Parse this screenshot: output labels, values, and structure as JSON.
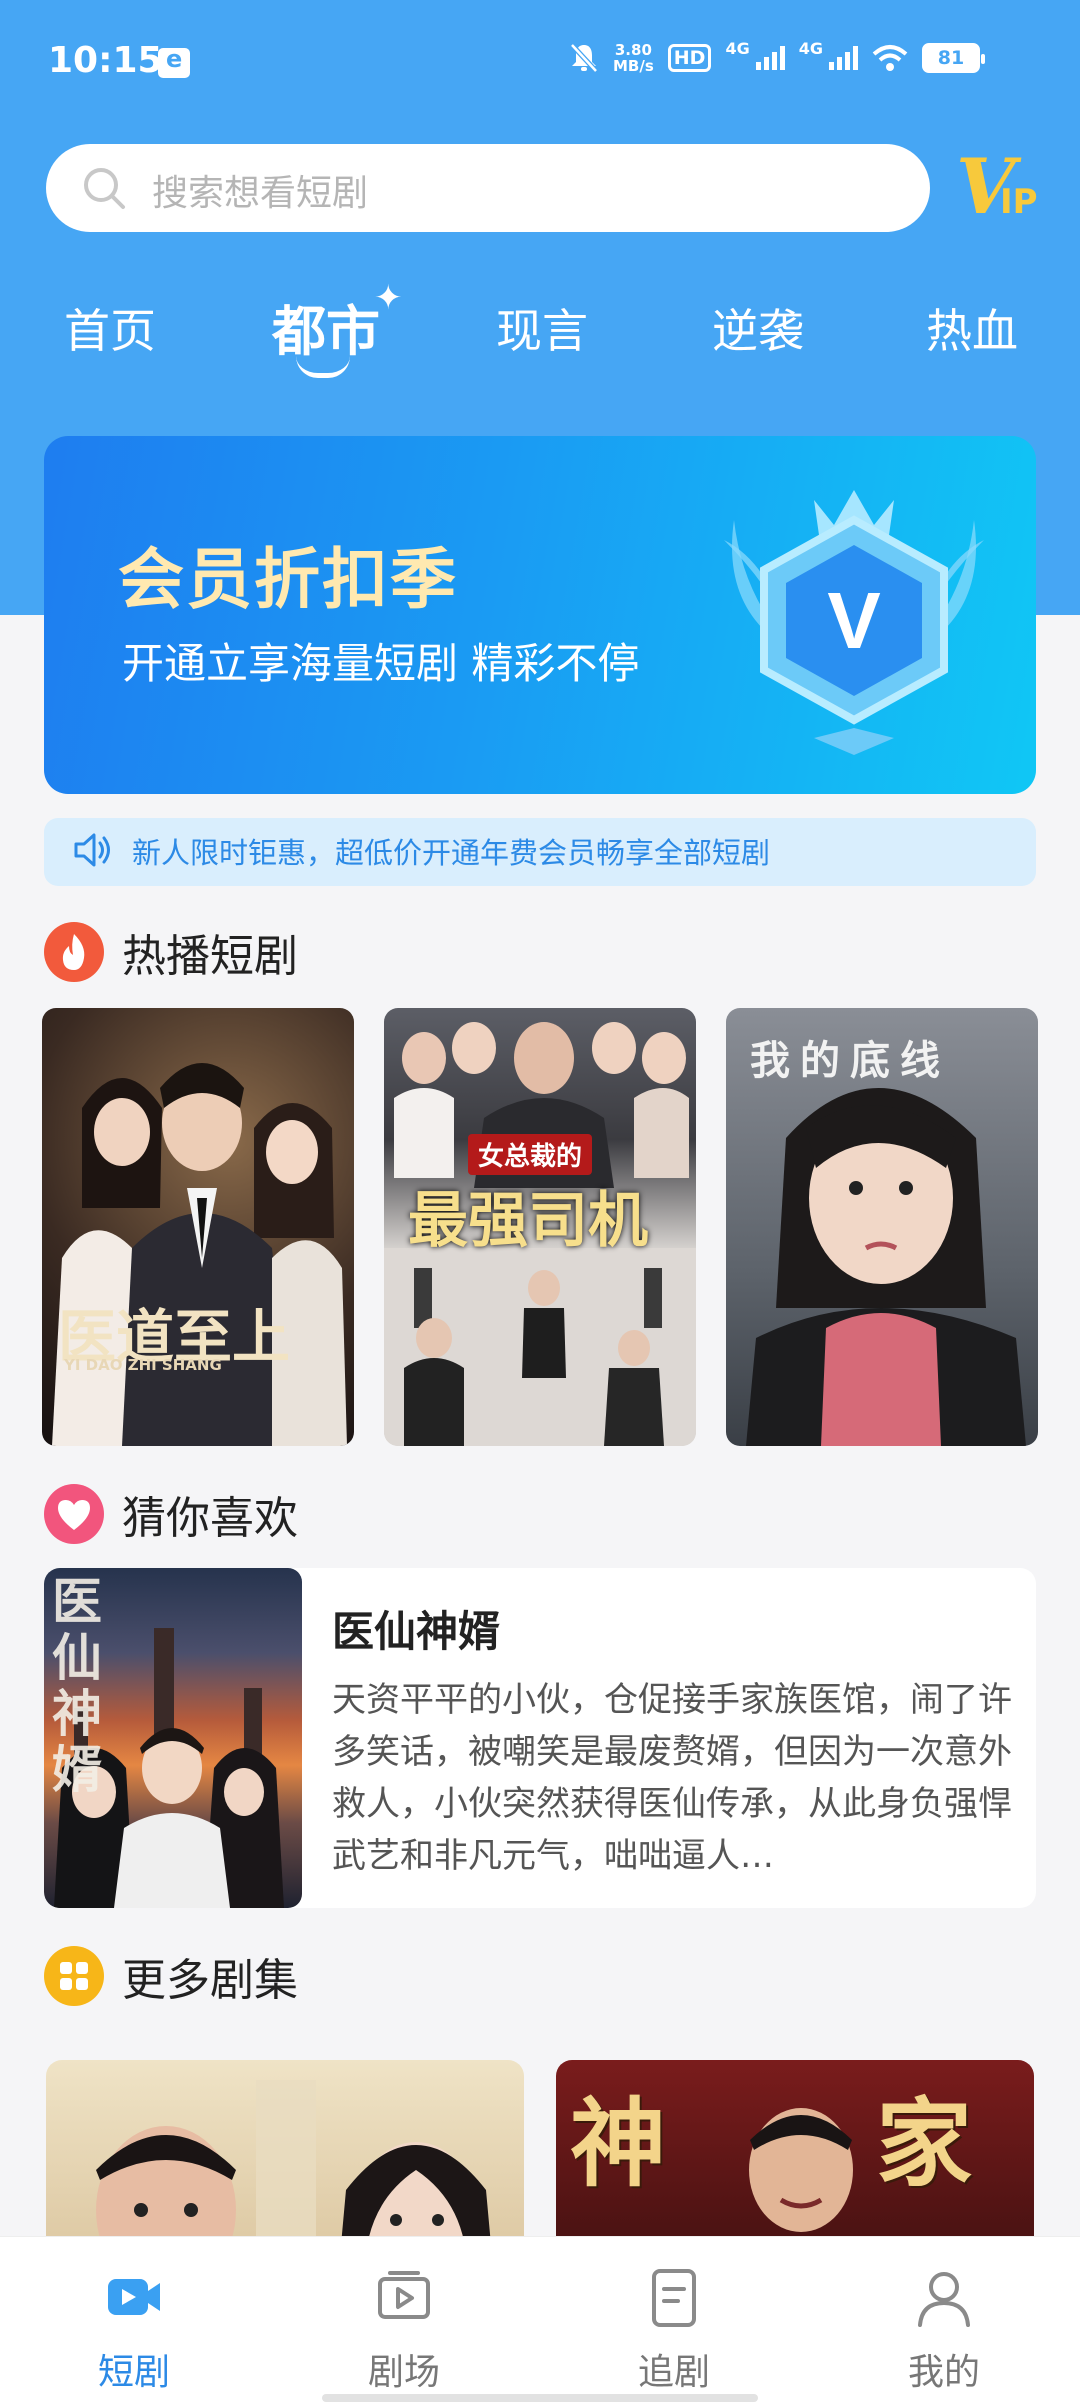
{
  "status_bar": {
    "time": "10:15",
    "speed_value": "3.80",
    "speed_unit": "MB/s",
    "hd": "HD",
    "sim1": "4G",
    "sim2": "4G",
    "battery": "81"
  },
  "search": {
    "placeholder": "搜索想看短剧"
  },
  "vip": {
    "v": "V",
    "ip": "IP"
  },
  "tabs": [
    {
      "label": "首页"
    },
    {
      "label": "都市",
      "active": true
    },
    {
      "label": "现言"
    },
    {
      "label": "逆袭"
    },
    {
      "label": "热血"
    }
  ],
  "banner": {
    "title": "会员折扣季",
    "subtitle": "开通立享海量短剧  精彩不停",
    "emblem_letter": "V"
  },
  "notice": {
    "text": "新人限时钜惠，超低价开通年费会员畅享全部短剧"
  },
  "hot": {
    "title": "热播短剧",
    "posters": [
      {
        "title": "医道至上",
        "pinyin": "YI DAO ZHI SHANG"
      },
      {
        "title": "最强司机",
        "tag": "女总裁的"
      },
      {
        "title": "我的底线"
      }
    ]
  },
  "recommend": {
    "title": "猜你喜欢",
    "item": {
      "title": "医仙神婿",
      "cover_text": "医仙神婿",
      "description": "天资平平的小伙，仓促接手家族医馆，闹了许多笑话，被嘲笑是最废赘婿，但因为一次意外救人，小伙突然获得医仙传承，从此身负强悍武艺和非凡元气，咄咄逼人…"
    }
  },
  "more": {
    "title": "更多剧集",
    "poster2_text_left": "神",
    "poster2_text_right": "家"
  },
  "bottom_nav": [
    {
      "label": "短剧",
      "active": true
    },
    {
      "label": "剧场"
    },
    {
      "label": "追剧"
    },
    {
      "label": "我的"
    }
  ],
  "colors": {
    "primary": "#46a6f4",
    "active_nav": "#2c8ae6",
    "banner_title": "#ffe9b0"
  }
}
